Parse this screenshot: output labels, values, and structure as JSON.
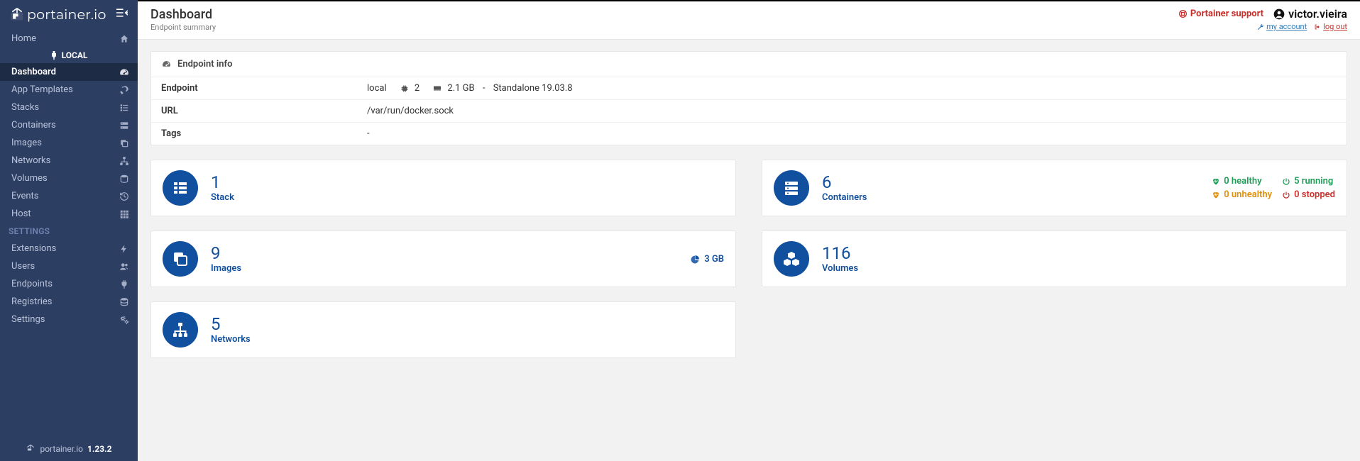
{
  "brand": "portainer.io",
  "footer_brand": "portainer.io",
  "version": "1.23.2",
  "header": {
    "title": "Dashboard",
    "subtitle": "Endpoint summary",
    "support": "Portainer support",
    "username": "victor.vieira",
    "my_account": " my account ",
    "log_out": " log out"
  },
  "sidebar": {
    "home": "Home",
    "endpoint_label": "LOCAL",
    "items": [
      {
        "label": "Dashboard"
      },
      {
        "label": "App Templates"
      },
      {
        "label": "Stacks"
      },
      {
        "label": "Containers"
      },
      {
        "label": "Images"
      },
      {
        "label": "Networks"
      },
      {
        "label": "Volumes"
      },
      {
        "label": "Events"
      },
      {
        "label": "Host"
      }
    ],
    "settings_title": "SETTINGS",
    "settings": [
      {
        "label": "Extensions"
      },
      {
        "label": "Users"
      },
      {
        "label": "Endpoints"
      },
      {
        "label": "Registries"
      },
      {
        "label": "Settings"
      }
    ]
  },
  "endpoint_panel": {
    "title": "Endpoint info",
    "rows": {
      "endpoint_key": "Endpoint",
      "endpoint_name": "local",
      "cpu_count": "2",
      "mem": "2.1 GB",
      "mode": "Standalone 19.03.8",
      "url_key": "URL",
      "url_val": "/var/run/docker.sock",
      "tags_key": "Tags",
      "tags_val": "-"
    }
  },
  "tiles": {
    "stacks": {
      "count": "1",
      "label": "Stack"
    },
    "containers": {
      "count": "6",
      "label": "Containers",
      "status": {
        "healthy": "0 healthy",
        "running": "5 running",
        "unhealthy": "0 unhealthy",
        "stopped": "0 stopped"
      }
    },
    "images": {
      "count": "9",
      "label": "Images",
      "size": "3 GB"
    },
    "volumes": {
      "count": "116",
      "label": "Volumes"
    },
    "networks": {
      "count": "5",
      "label": "Networks"
    }
  }
}
